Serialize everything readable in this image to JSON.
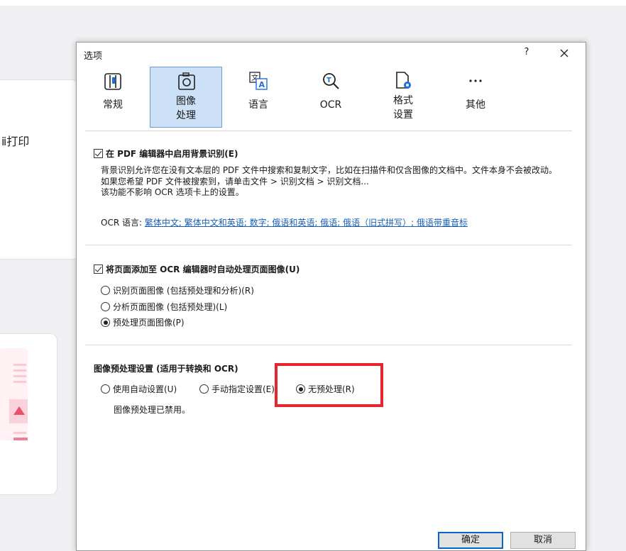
{
  "background": {
    "card_text": "ⅱ打印"
  },
  "dialog": {
    "title": "选项",
    "help": "?",
    "tabs": [
      {
        "label": "常规",
        "icon": "general-settings-icon",
        "selected": false
      },
      {
        "label": "图像\n处理",
        "icon": "camera-icon",
        "selected": true
      },
      {
        "label": "语言",
        "icon": "language-icon",
        "selected": false
      },
      {
        "label": "OCR",
        "icon": "ocr-icon",
        "selected": false
      },
      {
        "label": "格式\n设置",
        "icon": "format-settings-icon",
        "selected": false
      },
      {
        "label": "其他",
        "icon": "more-icon",
        "selected": false
      }
    ],
    "background_recognition": {
      "checkbox_label": "在 PDF 编辑器中启用背景识别(E)",
      "checked": true,
      "description": "背景识别允许您在没有文本层的 PDF 文件中搜索和复制文字，比如在扫描件和仅含图像的文档中。文件本身不会被改动。如果您希望 PDF 文件被搜索到，请单击文件 > 识别文档 > 识别文档...",
      "note": "该功能不影响 OCR 选项卡上的设置。",
      "ocr_language_label": "OCR 语言:",
      "ocr_language_value": "繁体中文; 繁体中文和英语; 数字; 俄语和英语; 俄语; 俄语（旧式拼写）; 俄语带重音标"
    },
    "auto_process": {
      "checkbox_label": "将页面添加至 OCR 编辑器时自动处理页面图像(U)",
      "checked": true,
      "options": [
        {
          "label": "识别页面图像 (包括预处理和分析)(R)",
          "selected": false
        },
        {
          "label": "分析页面图像 (包括预处理)(L)",
          "selected": false
        },
        {
          "label": "预处理页面图像(P)",
          "selected": true
        }
      ]
    },
    "preprocessing": {
      "title": "图像预处理设置 (适用于转换和 OCR)",
      "options": [
        {
          "label": "使用自动设置(U)",
          "selected": false
        },
        {
          "label": "手动指定设置(E)",
          "selected": false
        },
        {
          "label": "无预处理(R)",
          "selected": true
        }
      ],
      "status": "图像预处理已禁用。"
    },
    "buttons": {
      "ok": "确定",
      "cancel": "取消"
    },
    "highlight_color": "#e8242c",
    "selected_tab_color": "#cce1f7"
  }
}
